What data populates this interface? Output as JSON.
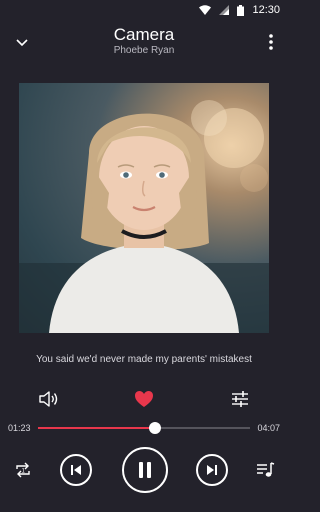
{
  "status_bar": {
    "time": "12:30",
    "icons": [
      "wifi-icon",
      "signal-icon",
      "battery-icon"
    ]
  },
  "header": {
    "title": "Camera",
    "artist": "Phoebe Ryan",
    "back_icon": "chevron-down-icon",
    "menu_icon": "more-vert-icon"
  },
  "album_art": {
    "description_icon": "album-art-image"
  },
  "lyric": "You said we'd never made my parents' mistakest",
  "actions": {
    "volume_icon": "volume-icon",
    "favorite_icon": "heart-icon",
    "equalizer_icon": "equalizer-icon",
    "favorite_color": "#e8374c"
  },
  "playback": {
    "current_time": "01:23",
    "duration": "04:07",
    "progress_fraction": 0.55
  },
  "controls": {
    "repeat_icon": "repeat-icon",
    "previous_icon": "skip-previous-icon",
    "pause_icon": "pause-icon",
    "next_icon": "skip-next-icon",
    "queue_icon": "queue-music-icon"
  },
  "colors": {
    "background": "#23222b",
    "accent": "#e8374c"
  }
}
